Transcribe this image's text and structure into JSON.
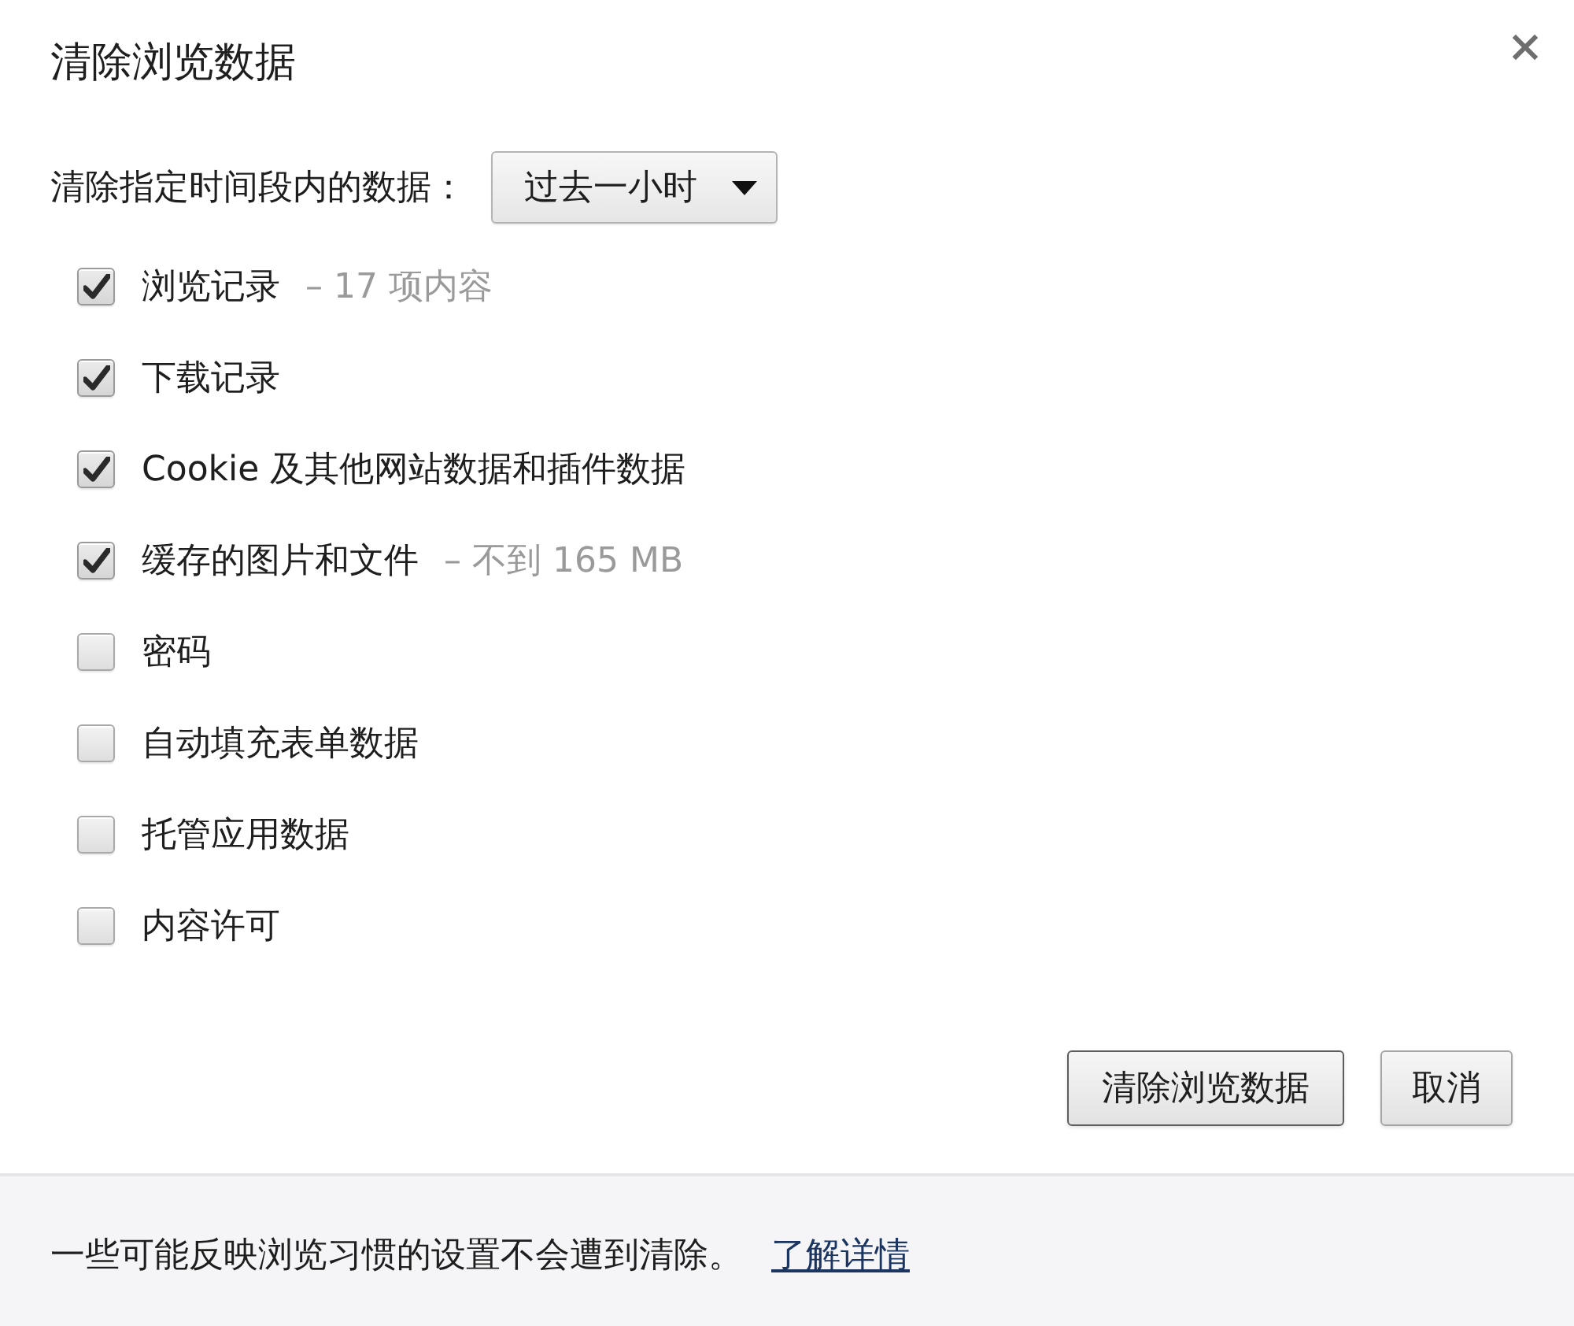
{
  "dialog": {
    "title": "清除浏览数据"
  },
  "time_range": {
    "label": "清除指定时间段内的数据：",
    "value": "过去一小时"
  },
  "options": [
    {
      "label": "浏览记录",
      "detail": "– 17 项内容",
      "checked": true
    },
    {
      "label": "下载记录",
      "checked": true
    },
    {
      "label": "Cookie 及其他网站数据和插件数据",
      "checked": true
    },
    {
      "label": "缓存的图片和文件",
      "detail": "– 不到 165 MB",
      "checked": true
    },
    {
      "label": "密码",
      "checked": false
    },
    {
      "label": "自动填充表单数据",
      "checked": false
    },
    {
      "label": "托管应用数据",
      "checked": false
    },
    {
      "label": "内容许可",
      "checked": false
    }
  ],
  "buttons": [
    {
      "label": "清除浏览数据",
      "kind": "primary"
    },
    {
      "label": "取消",
      "kind": "secondary"
    }
  ],
  "footer": {
    "text": "一些可能反映浏览习惯的设置不会遭到清除。",
    "link": "了解详情"
  }
}
